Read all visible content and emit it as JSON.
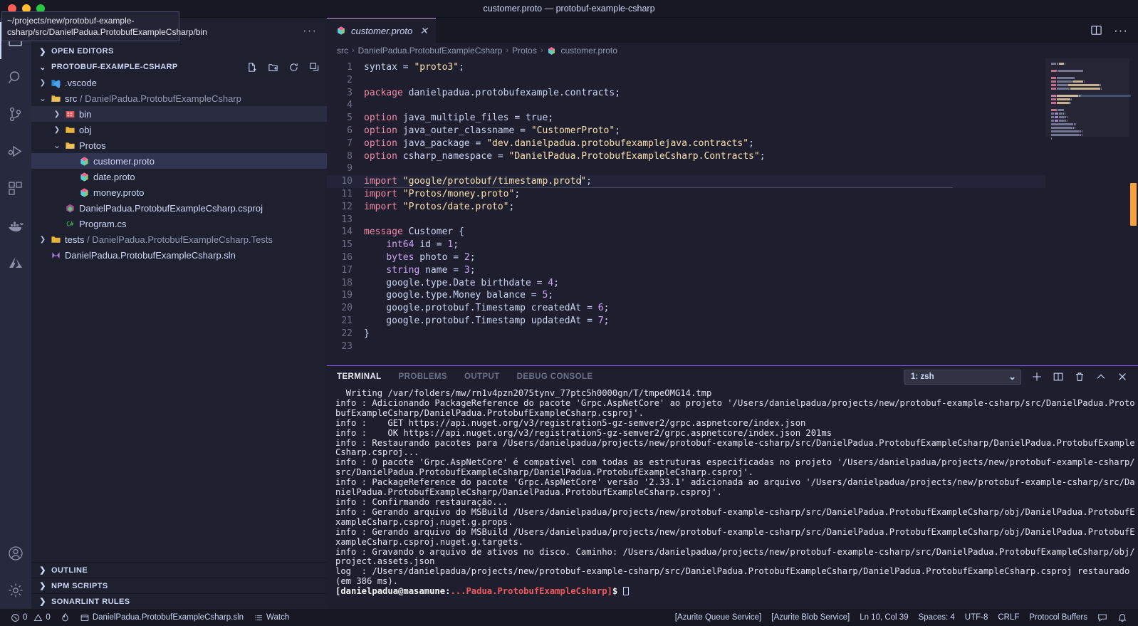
{
  "window": {
    "title": "customer.proto — protobuf-example-csharp",
    "traffic_lights": [
      "close",
      "minimize",
      "zoom"
    ]
  },
  "tooltip": {
    "text": "~/projects/new/protobuf-example-csharp/src/DanielPadua.ProtobufExampleCsharp/bin"
  },
  "activitybar": {
    "items": [
      {
        "name": "explorer",
        "icon": "files-icon",
        "active": true
      },
      {
        "name": "search",
        "icon": "search-icon",
        "active": false
      },
      {
        "name": "source-control",
        "icon": "source-control-icon",
        "active": false
      },
      {
        "name": "run-and-debug",
        "icon": "run-debug-icon",
        "active": false
      },
      {
        "name": "extensions",
        "icon": "extensions-icon",
        "active": false
      },
      {
        "name": "docker",
        "icon": "docker-icon",
        "active": false
      },
      {
        "name": "azure",
        "icon": "azure-icon",
        "active": false
      }
    ],
    "bottom": [
      {
        "name": "accounts",
        "icon": "account-icon"
      },
      {
        "name": "settings",
        "icon": "gear-icon"
      }
    ]
  },
  "sidebar": {
    "more_actions": "···",
    "open_editors": {
      "label": "OPEN EDITORS",
      "expanded": false
    },
    "workspace": {
      "label": "PROTOBUF-EXAMPLE-CSHARP",
      "expanded": true,
      "actions": [
        "new-file-icon",
        "new-folder-icon",
        "refresh-icon",
        "collapse-all-icon"
      ]
    },
    "tree": [
      {
        "label": ".vscode",
        "indent": 1,
        "kind": "folder",
        "icon": "vscode-folder-icon",
        "twist": "collapsed",
        "selected": false
      },
      {
        "label": "src",
        "dim_suffix": " / DanielPadua.ProtobufExampleCsharp",
        "indent": 1,
        "kind": "folder",
        "icon": "folder-open-icon",
        "twist": "expanded",
        "selected": false
      },
      {
        "label": "bin",
        "indent": 2,
        "kind": "folder",
        "icon": "bin-folder-icon",
        "twist": "collapsed",
        "selected": false,
        "highlight": true
      },
      {
        "label": "obj",
        "indent": 2,
        "kind": "folder",
        "icon": "folder-icon",
        "twist": "collapsed",
        "selected": false
      },
      {
        "label": "Protos",
        "indent": 2,
        "kind": "folder",
        "icon": "folder-open-icon",
        "twist": "expanded",
        "selected": false
      },
      {
        "label": "customer.proto",
        "indent": 3,
        "kind": "file",
        "icon": "proto-icon",
        "twist": "none",
        "selected": true
      },
      {
        "label": "date.proto",
        "indent": 3,
        "kind": "file",
        "icon": "proto-icon",
        "twist": "none",
        "selected": false
      },
      {
        "label": "money.proto",
        "indent": 3,
        "kind": "file",
        "icon": "proto-icon",
        "twist": "none",
        "selected": false
      },
      {
        "label": "DanielPadua.ProtobufExampleCsharp.csproj",
        "indent": 2,
        "kind": "file",
        "icon": "csproj-icon",
        "twist": "none",
        "selected": false
      },
      {
        "label": "Program.cs",
        "indent": 2,
        "kind": "file",
        "icon": "csharp-icon",
        "twist": "none",
        "selected": false
      },
      {
        "label": "tests",
        "dim_suffix": " / DanielPadua.ProtobufExampleCsharp.Tests",
        "indent": 1,
        "kind": "folder",
        "icon": "folder-icon",
        "twist": "collapsed",
        "selected": false
      },
      {
        "label": "DanielPadua.ProtobufExampleCsharp.sln",
        "indent": 1,
        "kind": "file",
        "icon": "sln-icon",
        "twist": "none",
        "selected": false
      }
    ],
    "panels": [
      {
        "label": "OUTLINE",
        "expanded": false
      },
      {
        "label": "NPM SCRIPTS",
        "expanded": false
      },
      {
        "label": "SONARLINT RULES",
        "expanded": false
      }
    ]
  },
  "editor": {
    "tab": {
      "label": "customer.proto",
      "icon": "proto-icon",
      "close": "✕",
      "dirty": false
    },
    "tab_actions": [
      "split-editor-icon",
      "more-actions-icon"
    ],
    "breadcrumbs": [
      "src",
      "DanielPadua.ProtobufExampleCsharp",
      "Protos",
      "customer.proto"
    ],
    "breadcrumb_separator": "›",
    "current_line": 10,
    "lines": [
      {
        "n": 1,
        "tokens": [
          {
            "t": "pln",
            "v": "syntax "
          },
          {
            "t": "pln",
            "v": "= "
          },
          {
            "t": "str",
            "v": "\"proto3\""
          },
          {
            "t": "pln",
            "v": ";"
          }
        ]
      },
      {
        "n": 2,
        "tokens": []
      },
      {
        "n": 3,
        "tokens": [
          {
            "t": "kw",
            "v": "package "
          },
          {
            "t": "pln",
            "v": "danielpadua.protobufexample.contracts;"
          }
        ]
      },
      {
        "n": 4,
        "tokens": []
      },
      {
        "n": 5,
        "tokens": [
          {
            "t": "kw",
            "v": "option "
          },
          {
            "t": "pln",
            "v": "java_multiple_files = true;"
          }
        ]
      },
      {
        "n": 6,
        "tokens": [
          {
            "t": "kw",
            "v": "option "
          },
          {
            "t": "pln",
            "v": "java_outer_classname = "
          },
          {
            "t": "str",
            "v": "\"CustomerProto\""
          },
          {
            "t": "pln",
            "v": ";"
          }
        ]
      },
      {
        "n": 7,
        "tokens": [
          {
            "t": "kw",
            "v": "option "
          },
          {
            "t": "pln",
            "v": "java_package = "
          },
          {
            "t": "str",
            "v": "\"dev.danielpadua.protobufexamplejava.contracts\""
          },
          {
            "t": "pln",
            "v": ";"
          }
        ]
      },
      {
        "n": 8,
        "tokens": [
          {
            "t": "kw",
            "v": "option "
          },
          {
            "t": "pln",
            "v": "csharp_namespace = "
          },
          {
            "t": "str",
            "v": "\"DanielPadua.ProtobufExampleCsharp.Contracts\""
          },
          {
            "t": "pln",
            "v": ";"
          }
        ]
      },
      {
        "n": 9,
        "tokens": []
      },
      {
        "n": 10,
        "tokens": [
          {
            "t": "kw",
            "v": "import "
          },
          {
            "t": "str",
            "v": "\"google/protobuf/timestamp.proto"
          },
          {
            "t": "caret",
            "v": ""
          },
          {
            "t": "str",
            "v": "\""
          },
          {
            "t": "pln",
            "v": ";"
          }
        ]
      },
      {
        "n": 11,
        "tokens": [
          {
            "t": "kw",
            "v": "import "
          },
          {
            "t": "str",
            "v": "\"Protos/money.proto\""
          },
          {
            "t": "pln",
            "v": ";"
          }
        ]
      },
      {
        "n": 12,
        "tokens": [
          {
            "t": "kw",
            "v": "import "
          },
          {
            "t": "str",
            "v": "\"Protos/date.proto\""
          },
          {
            "t": "pln",
            "v": ";"
          }
        ]
      },
      {
        "n": 13,
        "tokens": []
      },
      {
        "n": 14,
        "tokens": [
          {
            "t": "kw",
            "v": "message "
          },
          {
            "t": "pln",
            "v": "Customer {"
          }
        ]
      },
      {
        "n": 15,
        "tokens": [
          {
            "t": "pln",
            "v": "    "
          },
          {
            "t": "typ",
            "v": "int64"
          },
          {
            "t": "pln",
            "v": " id = "
          },
          {
            "t": "num",
            "v": "1"
          },
          {
            "t": "pln",
            "v": ";"
          }
        ]
      },
      {
        "n": 16,
        "tokens": [
          {
            "t": "pln",
            "v": "    "
          },
          {
            "t": "typ",
            "v": "bytes"
          },
          {
            "t": "pln",
            "v": " photo = "
          },
          {
            "t": "num",
            "v": "2"
          },
          {
            "t": "pln",
            "v": ";"
          }
        ]
      },
      {
        "n": 17,
        "tokens": [
          {
            "t": "pln",
            "v": "    "
          },
          {
            "t": "typ",
            "v": "string"
          },
          {
            "t": "pln",
            "v": " name = "
          },
          {
            "t": "num",
            "v": "3"
          },
          {
            "t": "pln",
            "v": ";"
          }
        ]
      },
      {
        "n": 18,
        "tokens": [
          {
            "t": "pln",
            "v": "    google.type.Date birthdate = "
          },
          {
            "t": "num",
            "v": "4"
          },
          {
            "t": "pln",
            "v": ";"
          }
        ]
      },
      {
        "n": 19,
        "tokens": [
          {
            "t": "pln",
            "v": "    google.type.Money balance = "
          },
          {
            "t": "num",
            "v": "5"
          },
          {
            "t": "pln",
            "v": ";"
          }
        ]
      },
      {
        "n": 20,
        "tokens": [
          {
            "t": "pln",
            "v": "    google.protobuf.Timestamp createdAt = "
          },
          {
            "t": "num",
            "v": "6"
          },
          {
            "t": "pln",
            "v": ";"
          }
        ]
      },
      {
        "n": 21,
        "tokens": [
          {
            "t": "pln",
            "v": "    google.protobuf.Timestamp updatedAt = "
          },
          {
            "t": "num",
            "v": "7"
          },
          {
            "t": "pln",
            "v": ";"
          }
        ]
      },
      {
        "n": 22,
        "tokens": [
          {
            "t": "pln",
            "v": "}"
          }
        ]
      },
      {
        "n": 23,
        "tokens": []
      }
    ]
  },
  "panel": {
    "tabs": [
      {
        "label": "TERMINAL",
        "active": true
      },
      {
        "label": "PROBLEMS",
        "active": false
      },
      {
        "label": "OUTPUT",
        "active": false
      },
      {
        "label": "DEBUG CONSOLE",
        "active": false
      }
    ],
    "terminal_select": {
      "value": "1: zsh",
      "chevron": "⌄"
    },
    "controls": [
      "new-terminal-icon",
      "split-terminal-icon",
      "kill-terminal-icon",
      "maximize-panel-icon",
      "close-panel-icon"
    ],
    "output": "  Writing /var/folders/mw/rn1v4pzn2075tynv_77ptc5h0000gn/T/tmpeOMG14.tmp\ninfo : Adicionando PackageReference do pacote 'Grpc.AspNetCore' ao projeto '/Users/danielpadua/projects/new/protobuf-example-csharp/src/DanielPadua.ProtobufExampleCsharp/DanielPadua.ProtobufExampleCsharp.csproj'.\ninfo :    GET https://api.nuget.org/v3/registration5-gz-semver2/grpc.aspnetcore/index.json\ninfo :    OK https://api.nuget.org/v3/registration5-gz-semver2/grpc.aspnetcore/index.json 201ms\ninfo : Restaurando pacotes para /Users/danielpadua/projects/new/protobuf-example-csharp/src/DanielPadua.ProtobufExampleCsharp/DanielPadua.ProtobufExampleCsharp.csproj...\ninfo : O pacote 'Grpc.AspNetCore' é compatível com todas as estruturas especificadas no projeto '/Users/danielpadua/projects/new/protobuf-example-csharp/src/DanielPadua.ProtobufExampleCsharp/DanielPadua.ProtobufExampleCsharp.csproj'.\ninfo : PackageReference do pacote 'Grpc.AspNetCore' versão '2.33.1' adicionada ao arquivo '/Users/danielpadua/projects/new/protobuf-example-csharp/src/DanielPadua.ProtobufExampleCsharp/DanielPadua.ProtobufExampleCsharp.csproj'.\ninfo : Confirmando restauração...\ninfo : Gerando arquivo do MSBuild /Users/danielpadua/projects/new/protobuf-example-csharp/src/DanielPadua.ProtobufExampleCsharp/obj/DanielPadua.ProtobufExampleCsharp.csproj.nuget.g.props.\ninfo : Gerando arquivo do MSBuild /Users/danielpadua/projects/new/protobuf-example-csharp/src/DanielPadua.ProtobufExampleCsharp/obj/DanielPadua.ProtobufExampleCsharp.csproj.nuget.g.targets.\ninfo : Gravando o arquivo de ativos no disco. Caminho: /Users/danielpadua/projects/new/protobuf-example-csharp/src/DanielPadua.ProtobufExampleCsharp/obj/project.assets.json\nlog  : /Users/danielpadua/projects/new/protobuf-example-csharp/src/DanielPadua.ProtobufExampleCsharp/DanielPadua.ProtobufExampleCsharp.csproj restaurado (em 386 ms).",
    "prompt_user": "[danielpadua@masamune:",
    "prompt_path": "...Padua.ProtobufExampleCsharp]",
    "prompt_symbol": "$"
  },
  "statusbar": {
    "left": [
      {
        "name": "problems",
        "icon": "error-icon",
        "text": "0"
      },
      {
        "name": "warnings",
        "icon": "warning-icon",
        "text": "0"
      },
      {
        "name": "sonarlint",
        "icon": "flame-icon",
        "text": ""
      },
      {
        "name": "solution",
        "icon": "window-icon",
        "text": "DanielPadua.ProtobufExampleCsharp.sln"
      },
      {
        "name": "watch",
        "icon": "list-icon",
        "text": "Watch"
      }
    ],
    "right": [
      {
        "name": "azurite-queue-service",
        "text": "[Azurite Queue Service]"
      },
      {
        "name": "azurite-blob-service",
        "text": "[Azurite Blob Service]"
      },
      {
        "name": "cursor-position",
        "text": "Ln 10, Col 39"
      },
      {
        "name": "indentation",
        "text": "Spaces: 4"
      },
      {
        "name": "encoding",
        "text": "UTF-8"
      },
      {
        "name": "eol",
        "text": "CRLF"
      },
      {
        "name": "language-mode",
        "text": "Protocol Buffers"
      },
      {
        "name": "feedback",
        "icon": "feedback-icon",
        "text": ""
      },
      {
        "name": "notifications",
        "icon": "bell-icon",
        "text": ""
      }
    ]
  },
  "colors": {
    "accent": "#cba6f7",
    "panel_accent": "#8b5cf6",
    "titlebar": "#181825",
    "sidebar": "#1e2030",
    "editor": "#1e1e2e",
    "string": "#f9e2af",
    "keyword": "#f38ba8",
    "type": "#cba6f7"
  }
}
